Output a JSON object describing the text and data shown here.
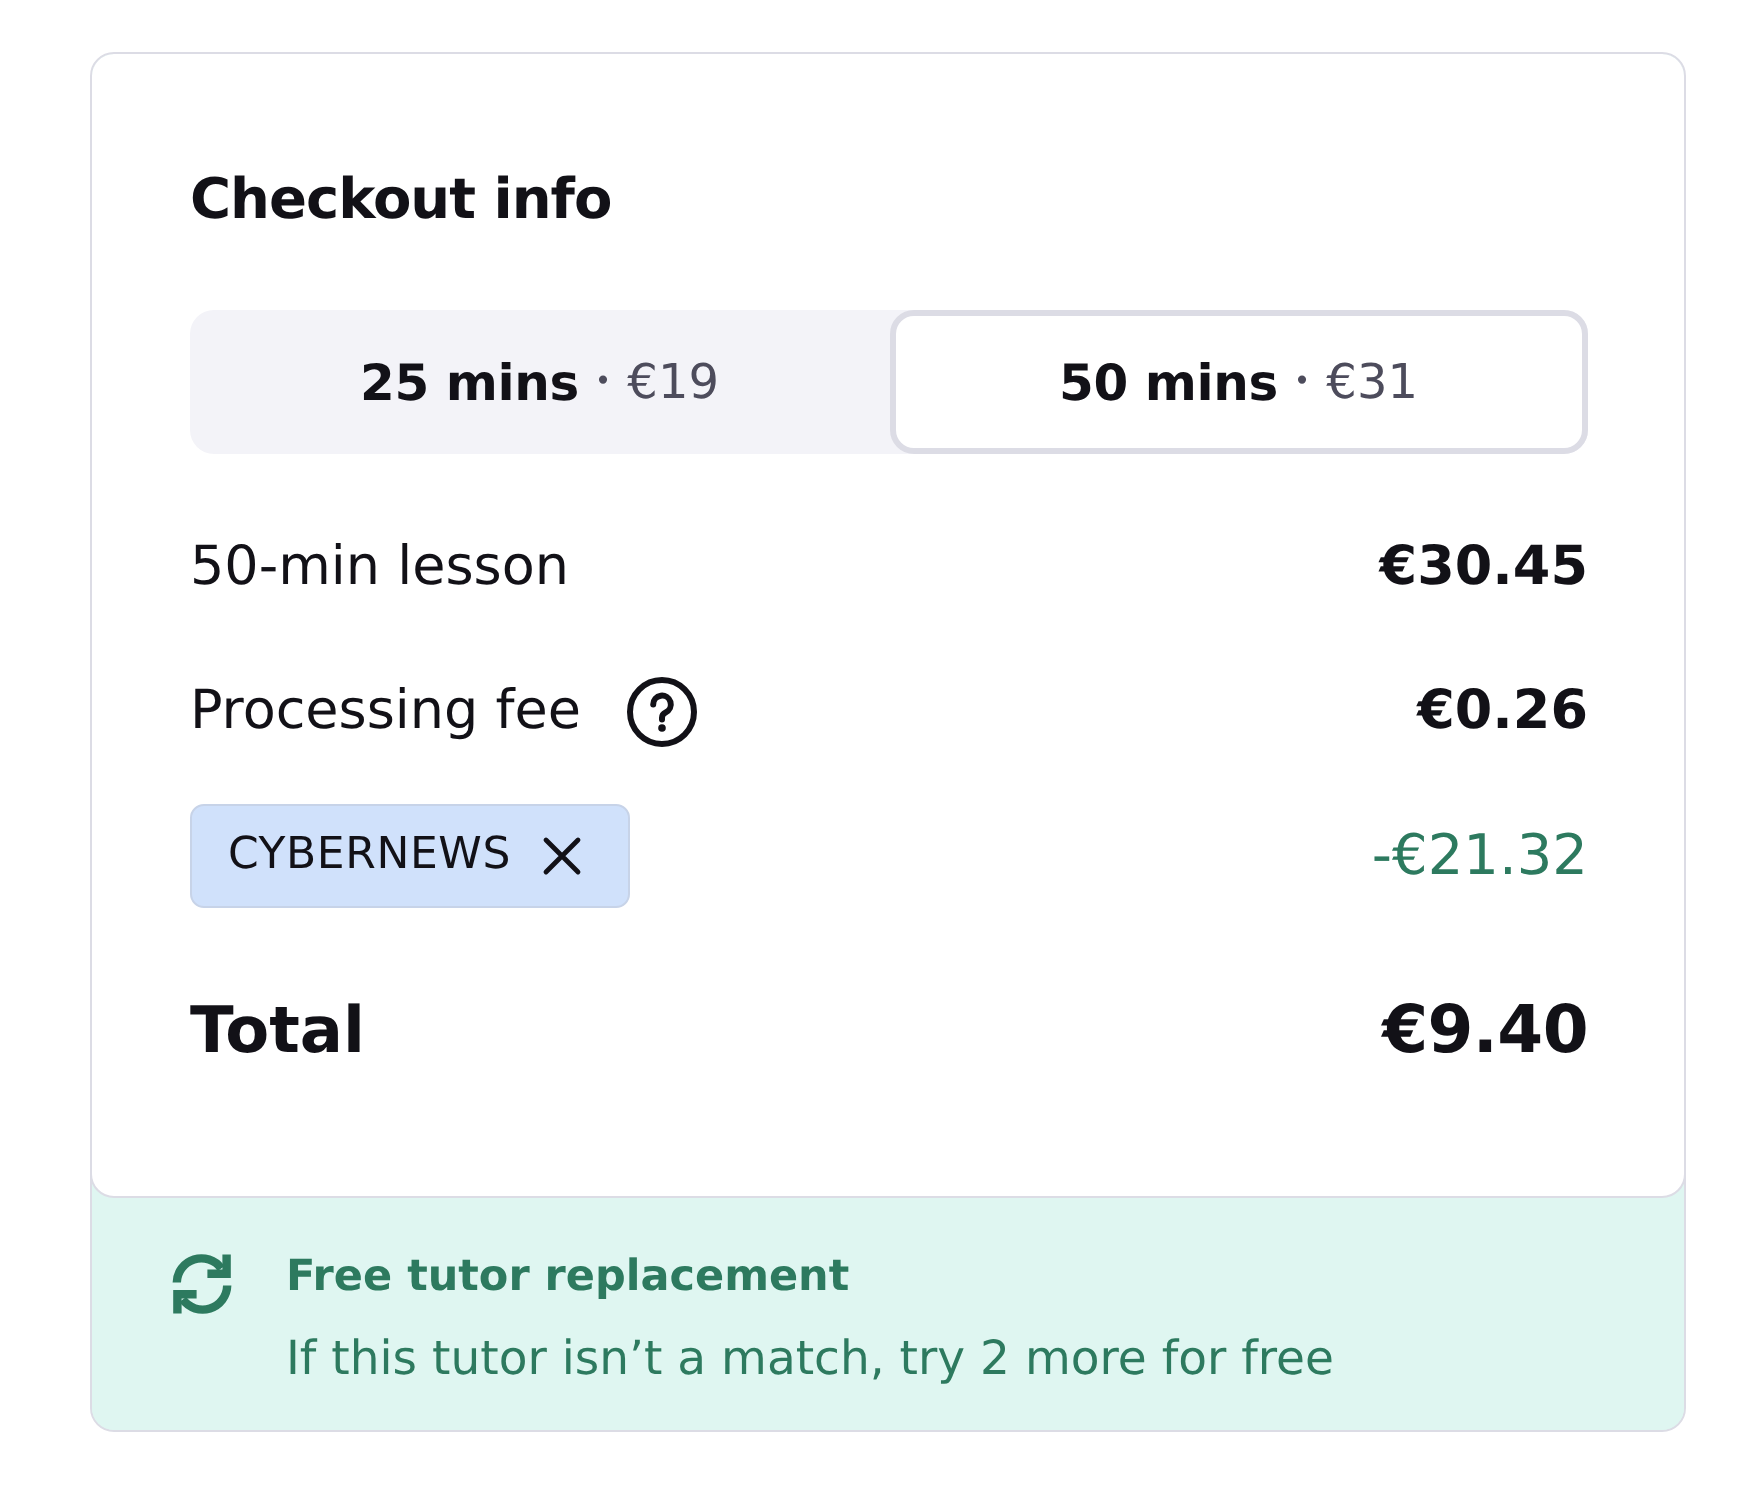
{
  "title": "Checkout info",
  "durations": [
    {
      "label": "25 mins",
      "separator": "•",
      "price": "€19",
      "selected": false
    },
    {
      "label": "50 mins",
      "separator": "•",
      "price": "€31",
      "selected": true
    }
  ],
  "line_items": [
    {
      "kind": "plain",
      "label": "50-min lesson",
      "amount": "€30.45"
    },
    {
      "kind": "help",
      "label": "Processing fee",
      "amount": "€0.26"
    },
    {
      "kind": "coupon",
      "label": "CYBERNEWS",
      "amount": "-€21.32"
    }
  ],
  "total": {
    "label": "Total",
    "amount": "€9.40"
  },
  "notice": {
    "title": "Free tutor replacement",
    "text": "If this tutor isn’t a match, try 2 more for free"
  }
}
